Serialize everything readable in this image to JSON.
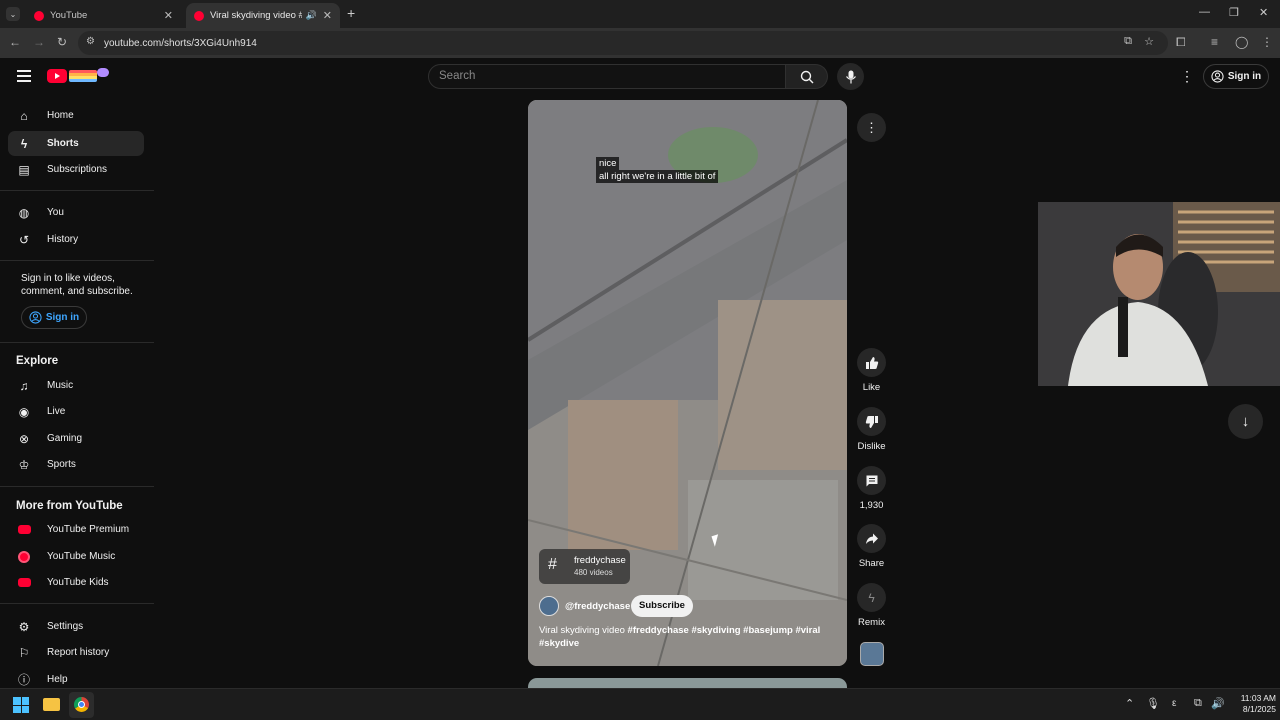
{
  "browser": {
    "tabs": [
      {
        "title": "YouTube"
      },
      {
        "title": "Viral skydiving video #fredd"
      }
    ],
    "url": "youtube.com/shorts/3XGi4Unh914"
  },
  "header": {
    "search_placeholder": "Search",
    "signin_label": "Sign in"
  },
  "sidebar": {
    "main": [
      {
        "label": "Home",
        "icon": "home-icon"
      },
      {
        "label": "Shorts",
        "icon": "shorts-icon"
      },
      {
        "label": "Subscriptions",
        "icon": "subscriptions-icon"
      }
    ],
    "you": [
      {
        "label": "You",
        "icon": "you-icon"
      },
      {
        "label": "History",
        "icon": "history-icon"
      }
    ],
    "signin_prompt": "Sign in to like videos, comment, and subscribe.",
    "signin_button": "Sign in",
    "explore_title": "Explore",
    "explore": [
      {
        "label": "Music",
        "icon": "music-icon"
      },
      {
        "label": "Live",
        "icon": "live-icon"
      },
      {
        "label": "Gaming",
        "icon": "gaming-icon"
      },
      {
        "label": "Sports",
        "icon": "sports-icon"
      }
    ],
    "more_title": "More from YouTube",
    "more": [
      {
        "label": "YouTube Premium",
        "icon": "youtube-premium-icon"
      },
      {
        "label": "YouTube Music",
        "icon": "youtube-music-icon"
      },
      {
        "label": "YouTube Kids",
        "icon": "youtube-kids-icon"
      }
    ],
    "footer": [
      {
        "label": "Settings",
        "icon": "settings-icon"
      },
      {
        "label": "Report history",
        "icon": "flag-icon"
      },
      {
        "label": "Help",
        "icon": "help-icon"
      }
    ]
  },
  "short": {
    "captions": [
      "nice",
      "all right we're in a little bit of"
    ],
    "hashtag_channel": "freddychase",
    "hashtag_count": "480 videos",
    "channel_handle": "@freddychase",
    "subscribe_label": "Subscribe",
    "description_plain": "Viral skydiving video ",
    "description_tags": "#freddychase #skydiving #basejump #viral #skydive"
  },
  "actions": [
    {
      "label": "Like",
      "icon": "thumbs-up-icon"
    },
    {
      "label": "Dislike",
      "icon": "thumbs-down-icon"
    },
    {
      "label": "1,930",
      "icon": "comment-icon"
    },
    {
      "label": "Share",
      "icon": "share-icon"
    },
    {
      "label": "Remix",
      "icon": "remix-icon"
    }
  ],
  "taskbar": {
    "time": "11:03 AM",
    "date": "8/1/2025"
  },
  "colors": {
    "youtube_red": "#ff0033",
    "link_blue": "#3ea6ff",
    "background": "#0f0f0f"
  }
}
